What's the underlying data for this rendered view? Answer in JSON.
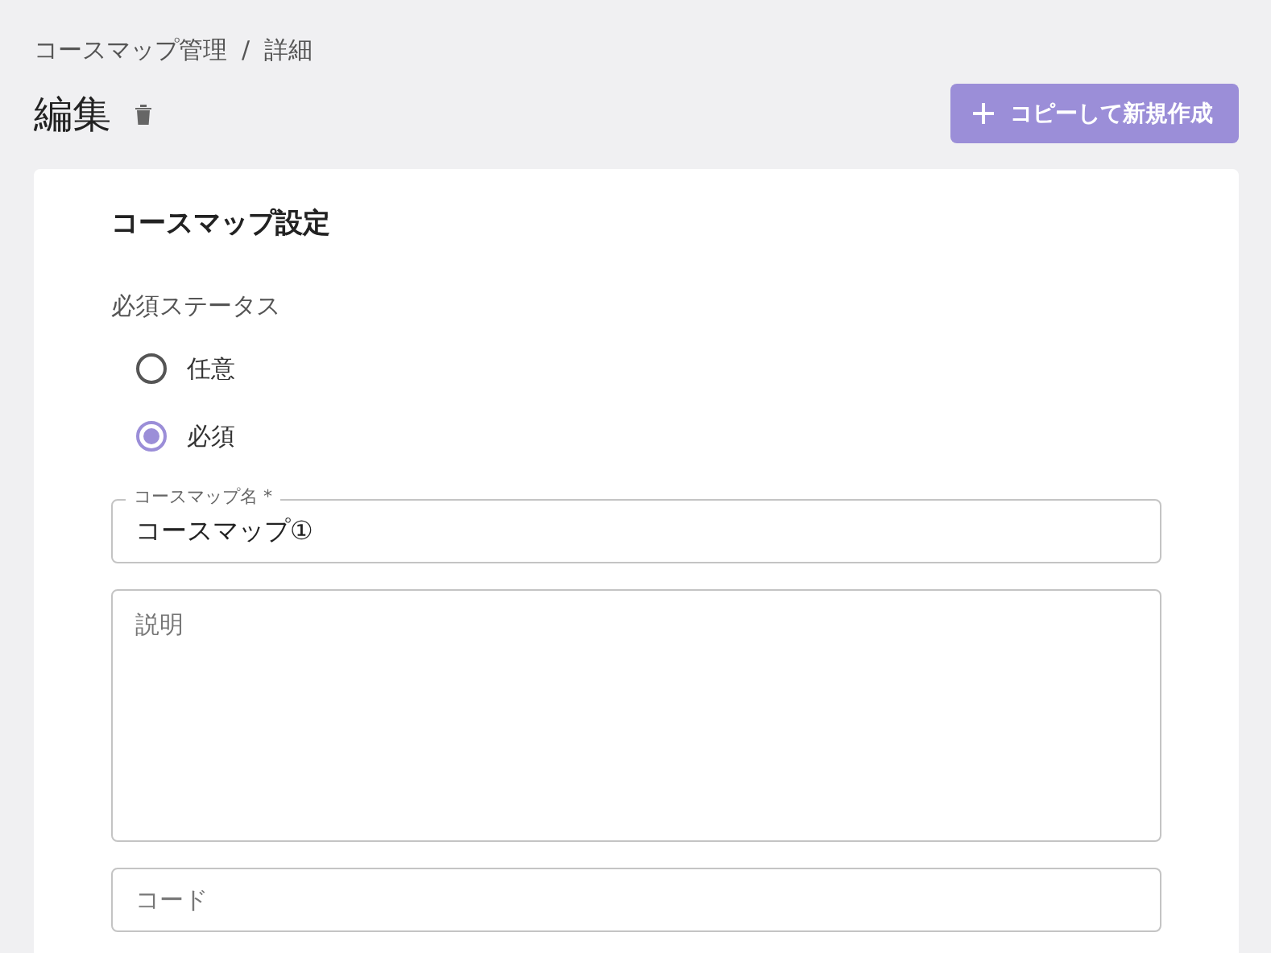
{
  "breadcrumb": [
    {
      "label": "コースマップ管理"
    },
    {
      "label": "詳細"
    }
  ],
  "breadcrumb_separator": "/",
  "page_title": "編集",
  "copy_button": {
    "label": "コピーして新規作成"
  },
  "card": {
    "title": "コースマップ設定",
    "required_status": {
      "label": "必須ステータス",
      "options": [
        {
          "label": "任意",
          "selected": false
        },
        {
          "label": "必須",
          "selected": true
        }
      ]
    },
    "name_field": {
      "label": "コースマップ名 *",
      "value": "コースマップ①"
    },
    "description_field": {
      "placeholder": "説明"
    },
    "code_field": {
      "placeholder": "コード"
    }
  }
}
